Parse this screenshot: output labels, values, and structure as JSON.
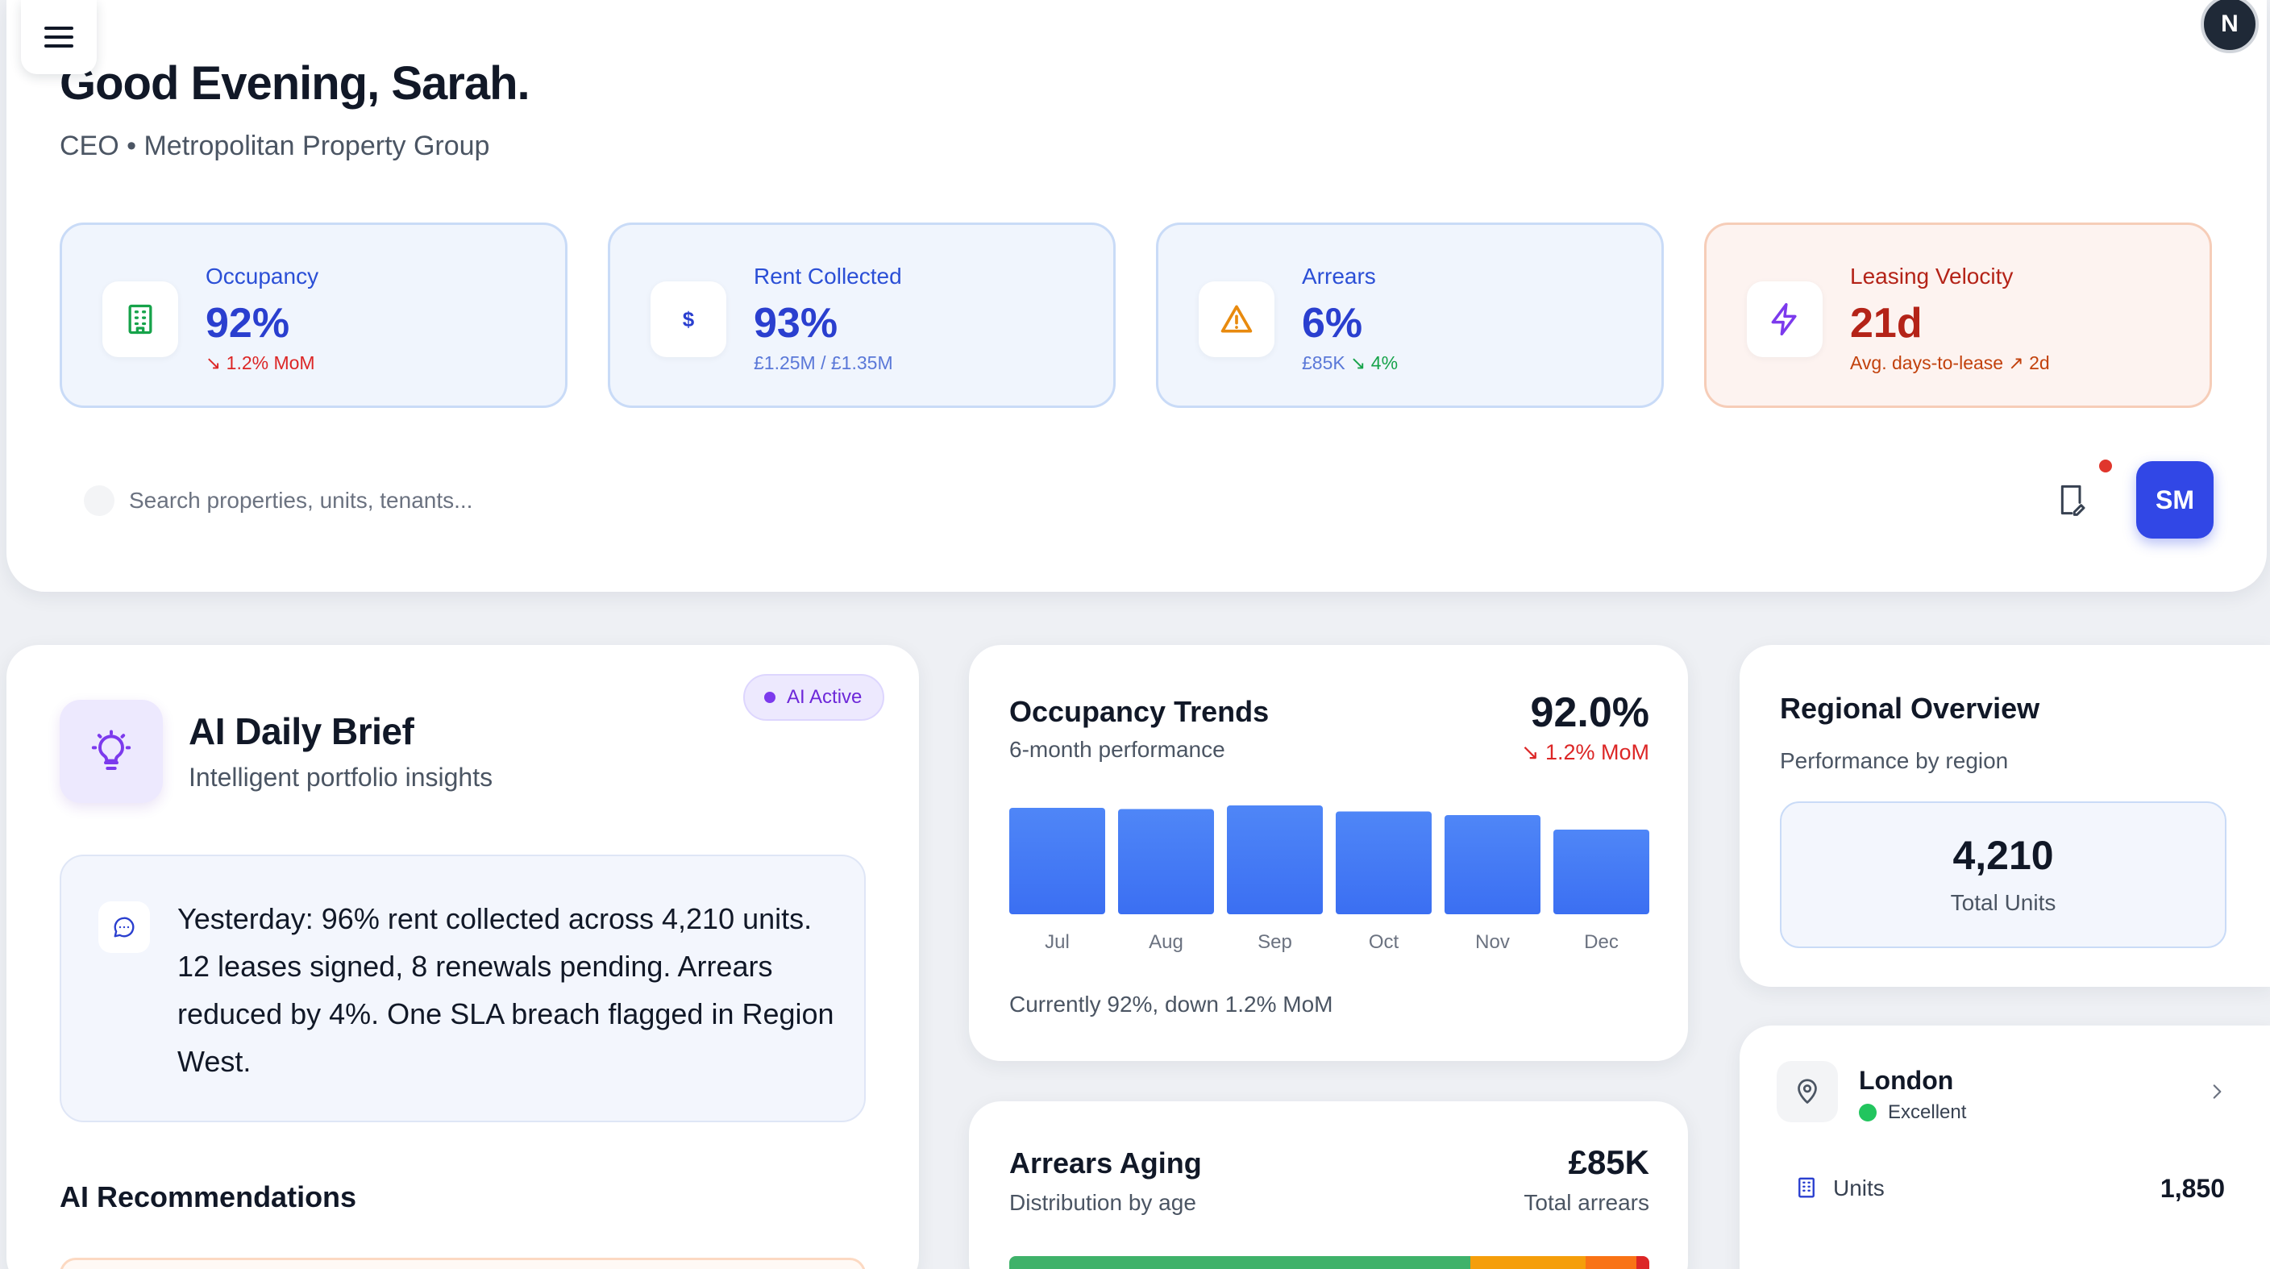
{
  "header": {
    "greeting": "Good Evening, Sarah.",
    "role": "CEO • Metropolitan Property Group",
    "avatar_initial": "N",
    "user_initials": "SM",
    "search": {
      "placeholder": "Search properties, units, tenants..."
    }
  },
  "kpis": [
    {
      "label": "Occupancy",
      "value": "92%",
      "change": "↘ 1.2% MoM",
      "icon": "building-icon"
    },
    {
      "label": "Rent Collected",
      "value": "93%",
      "sub": "£1.25M / £1.35M",
      "icon": "dollar-icon"
    },
    {
      "label": "Arrears",
      "value": "6%",
      "sub": "£85K",
      "change": "↘ 4%",
      "icon": "warning-triangle-icon"
    },
    {
      "label": "Leasing Velocity",
      "value": "21d",
      "sub": "Avg. days-to-lease",
      "change": "↗ 2d",
      "icon": "lightning-icon"
    }
  ],
  "brief": {
    "title": "AI Daily Brief",
    "subtitle": "Intelligent portfolio insights",
    "badge": "AI Active",
    "text": "Yesterday: 96% rent collected across 4,210 units. 12 leases signed, 8 renewals pending. Arrears reduced by 4%. One SLA breach flagged in Region West.",
    "recommendations_heading": "AI Recommendations"
  },
  "trends": {
    "title": "Occupancy Trends",
    "subtitle": "6-month performance",
    "value": "92.0%",
    "change": "↘ 1.2% MoM",
    "caption": "Currently 92%, down 1.2% MoM"
  },
  "chart_data": {
    "type": "bar",
    "categories": [
      "Jul",
      "Aug",
      "Sep",
      "Oct",
      "Nov",
      "Dec"
    ],
    "values": [
      93.8,
      93.7,
      94.0,
      93.5,
      93.2,
      92.0
    ],
    "ylim": [
      85,
      95
    ],
    "bar_color": "#4f86f7",
    "grid": false
  },
  "arrears": {
    "title": "Arrears Aging",
    "subtitle": "Distribution by age",
    "value": "£85K",
    "value_label": "Total arrears",
    "segments": [
      {
        "share": 0.72,
        "color": "#3fb26a"
      },
      {
        "share": 0.18,
        "color": "#f59e0b"
      },
      {
        "share": 0.08,
        "color": "#f97316"
      },
      {
        "share": 0.02,
        "color": "#dc2626"
      }
    ]
  },
  "regional": {
    "title": "Regional Overview",
    "subtitle": "Performance by region",
    "total_units": "4,210",
    "total_units_label": "Total Units",
    "region": {
      "name": "London",
      "status": "Excellent",
      "units_label": "Units",
      "units_value": "1,850"
    }
  },
  "colors": {
    "accent": "#3147e6",
    "kpi_blue": "#2a3fcf",
    "kpi_warm": "#b42318",
    "success": "#22c55e",
    "danger": "#dc2626"
  }
}
